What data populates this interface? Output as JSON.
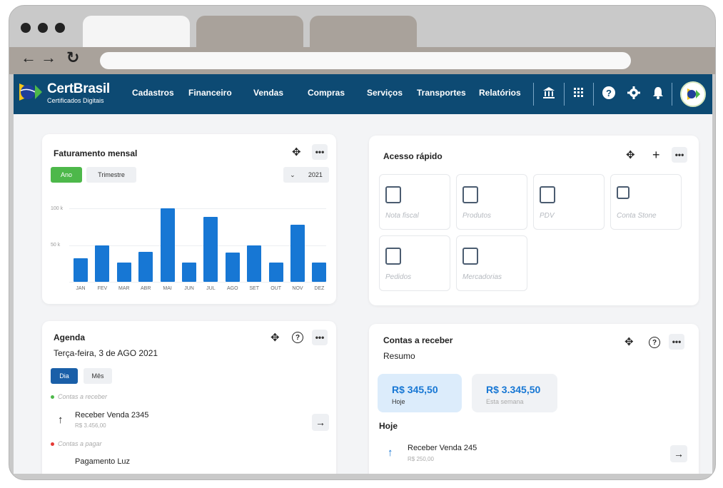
{
  "app": {
    "brand": "CertBrasil",
    "brand_sub": "Certificados Digitais",
    "menu": [
      "Cadastros",
      "Financeiro",
      "Vendas",
      "Compras",
      "Serviços",
      "Transportes",
      "Relatórios"
    ],
    "icons": [
      "bank-icon",
      "grid-apps-icon",
      "help-icon",
      "settings-icon",
      "bell-icon"
    ]
  },
  "faturamento": {
    "title": "Faturamento mensal",
    "toggle_ano": "Ano",
    "toggle_trimestre": "Trimestre",
    "year": "2021"
  },
  "chart_data": {
    "type": "bar",
    "categories": [
      "JAN",
      "FEV",
      "MAR",
      "ABR",
      "MAI",
      "JUN",
      "JUL",
      "AGO",
      "SET",
      "OUT",
      "NOV",
      "DEZ"
    ],
    "values": [
      32,
      50,
      26,
      41,
      100,
      26,
      88,
      40,
      50,
      26,
      78,
      26
    ],
    "y_ticks": [
      "100 k",
      "50 k"
    ],
    "ylim": [
      0,
      100
    ],
    "color": "#1777d4"
  },
  "acesso": {
    "title": "Acesso rápido",
    "tiles": [
      "Nota fiscal",
      "Produtos",
      "PDV",
      "Conta Stone",
      "Pedidos",
      "Mercadorias"
    ]
  },
  "agenda": {
    "title": "Agenda",
    "date": "Terça-feira, 3 de AGO 2021",
    "tab_dia": "Dia",
    "tab_mes": "Mês",
    "section_receber": "Contas a receber",
    "item1_title": "Receber Venda 2345",
    "item1_value": "R$ 3.456,00",
    "section_pagar": "Contas a pagar",
    "item2_title": "Pagamento Luz"
  },
  "contas": {
    "title": "Contas a receber",
    "subtitle": "Resumo",
    "stat1_value": "R$ 345,50",
    "stat1_label": "Hoje",
    "stat2_value": "R$ 3.345,50",
    "stat2_label": "Esta semana",
    "section_hoje": "Hoje",
    "item_title": "Receber Venda 245",
    "item_value": "R$ 250,00"
  }
}
